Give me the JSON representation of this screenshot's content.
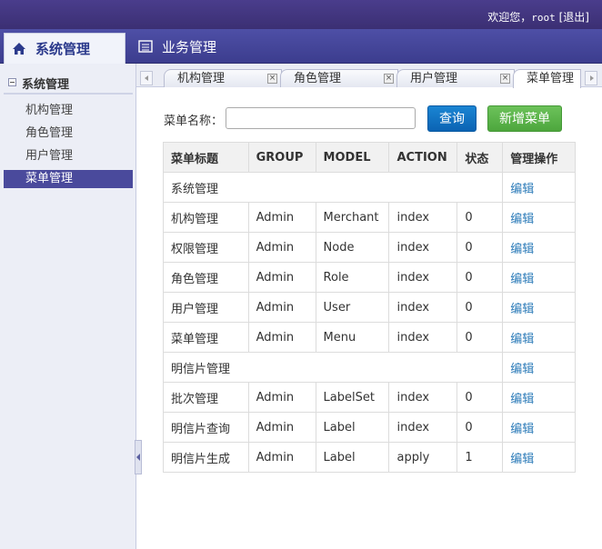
{
  "header": {
    "welcome": "欢迎您，",
    "username": "root",
    "logout": "[退出]"
  },
  "nav": {
    "tabs": [
      {
        "label": "系统管理"
      },
      {
        "label": "业务管理"
      }
    ]
  },
  "sidebar": {
    "group": "系统管理",
    "items": [
      {
        "label": "机构管理"
      },
      {
        "label": "角色管理"
      },
      {
        "label": "用户管理"
      },
      {
        "label": "菜单管理"
      }
    ],
    "active_index": 3
  },
  "tabs": [
    {
      "label": "机构管理",
      "close": "×"
    },
    {
      "label": "角色管理",
      "close": "×"
    },
    {
      "label": "用户管理",
      "close": "×"
    },
    {
      "label": "菜单管理"
    }
  ],
  "search": {
    "label": "菜单名称：",
    "value": "",
    "placeholder": ""
  },
  "buttons": {
    "query": "查询",
    "add": "新增菜单"
  },
  "table": {
    "headers": [
      "菜单标题",
      "GROUP",
      "MODEL",
      "ACTION",
      "状态",
      "管理操作"
    ],
    "rows": [
      {
        "title": "系统管理",
        "group": "",
        "model": "",
        "action": "",
        "status": "",
        "op": "编辑"
      },
      {
        "title": "机构管理",
        "group": "Admin",
        "model": "Merchant",
        "action": "index",
        "status": "0",
        "op": "编辑"
      },
      {
        "title": "权限管理",
        "group": "Admin",
        "model": "Node",
        "action": "index",
        "status": "0",
        "op": "编辑"
      },
      {
        "title": "角色管理",
        "group": "Admin",
        "model": "Role",
        "action": "index",
        "status": "0",
        "op": "编辑"
      },
      {
        "title": "用户管理",
        "group": "Admin",
        "model": "User",
        "action": "index",
        "status": "0",
        "op": "编辑"
      },
      {
        "title": "菜单管理",
        "group": "Admin",
        "model": "Menu",
        "action": "index",
        "status": "0",
        "op": "编辑"
      },
      {
        "title": "明信片管理",
        "group": "",
        "model": "",
        "action": "",
        "status": "",
        "op": "编辑"
      },
      {
        "title": "批次管理",
        "group": "Admin",
        "model": "LabelSet",
        "action": "index",
        "status": "0",
        "op": "编辑"
      },
      {
        "title": "明信片查询",
        "group": "Admin",
        "model": "Label",
        "action": "index",
        "status": "0",
        "op": "编辑"
      },
      {
        "title": "明信片生成",
        "group": "Admin",
        "model": "Label",
        "action": "apply",
        "status": "1",
        "op": "编辑"
      }
    ]
  },
  "colors": {
    "topbar": "#3b2f73",
    "navband": "#4e4fa6",
    "active_side": "#4a4a9c",
    "query_btn": "#0b63b3",
    "add_btn": "#4da63d",
    "link": "#2a7ab8"
  }
}
